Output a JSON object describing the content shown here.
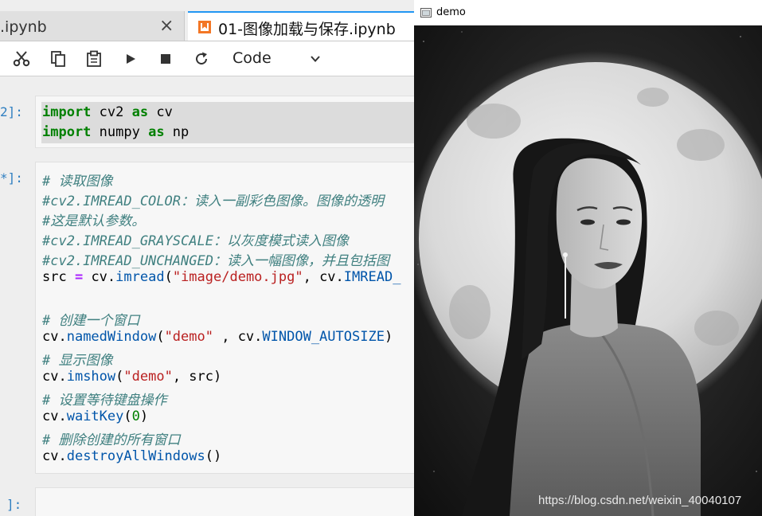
{
  "tabs": [
    {
      "label": ".ipynb",
      "close": "×"
    },
    {
      "label": "01-图像加载与保存.ipynb"
    }
  ],
  "toolbar": {
    "buttons": [
      "cut-icon",
      "copy-icon",
      "paste-icon",
      "run-icon",
      "stop-icon",
      "restart-icon"
    ],
    "cell_type": "Code"
  },
  "cells": [
    {
      "prompt": "2]:"
    },
    {
      "prompt": "*]:"
    },
    {
      "prompt": "]:"
    }
  ],
  "code": {
    "cell1": {
      "line1": {
        "kw1": "import",
        "t1": " cv2 ",
        "kw2": "as",
        "t2": " cv"
      },
      "line2": {
        "kw1": "import",
        "t1": " numpy ",
        "kw2": "as",
        "t2": " np"
      }
    },
    "cell2": {
      "c1": "# 读取图像",
      "c2": "#cv2.IMREAD_COLOR：读入一副彩色图像。图像的透明",
      "c3": "#这是默认参数。",
      "c4": "#cv2.IMREAD_GRAYSCALE：以灰度模式读入图像",
      "c5": "#cv2.IMREAD_UNCHANGED：读入一幅图像，并且包括图",
      "l6": {
        "a": "src ",
        "op": "=",
        "b": " cv.",
        "fn": "imread",
        "c": "(",
        "s": "\"image/demo.jpg\"",
        "d": ", cv.",
        "e": "IMREAD_"
      },
      "c7": "# 创建一个窗口",
      "l8": {
        "a": "cv.",
        "fn": "namedWindow",
        "b": "(",
        "s": "\"demo\"",
        "c": " , cv.",
        "d": "WINDOW_AUTOSIZE",
        "e": ")"
      },
      "c9": "# 显示图像",
      "l10": {
        "a": "cv.",
        "fn": "imshow",
        "b": "(",
        "s": "\"demo\"",
        "c": ", src)"
      },
      "c11": "# 设置等待键盘操作",
      "l12": {
        "a": "cv.",
        "fn": "waitKey",
        "b": "(",
        "n": "0",
        "c": ")"
      },
      "c13": "# 删除创建的所有窗口",
      "l14": {
        "a": "cv.",
        "fn": "destroyAllWindows",
        "b": "()"
      }
    }
  },
  "window": {
    "title": "demo",
    "watermark": "https://blog.csdn.net/weixin_40040107"
  }
}
